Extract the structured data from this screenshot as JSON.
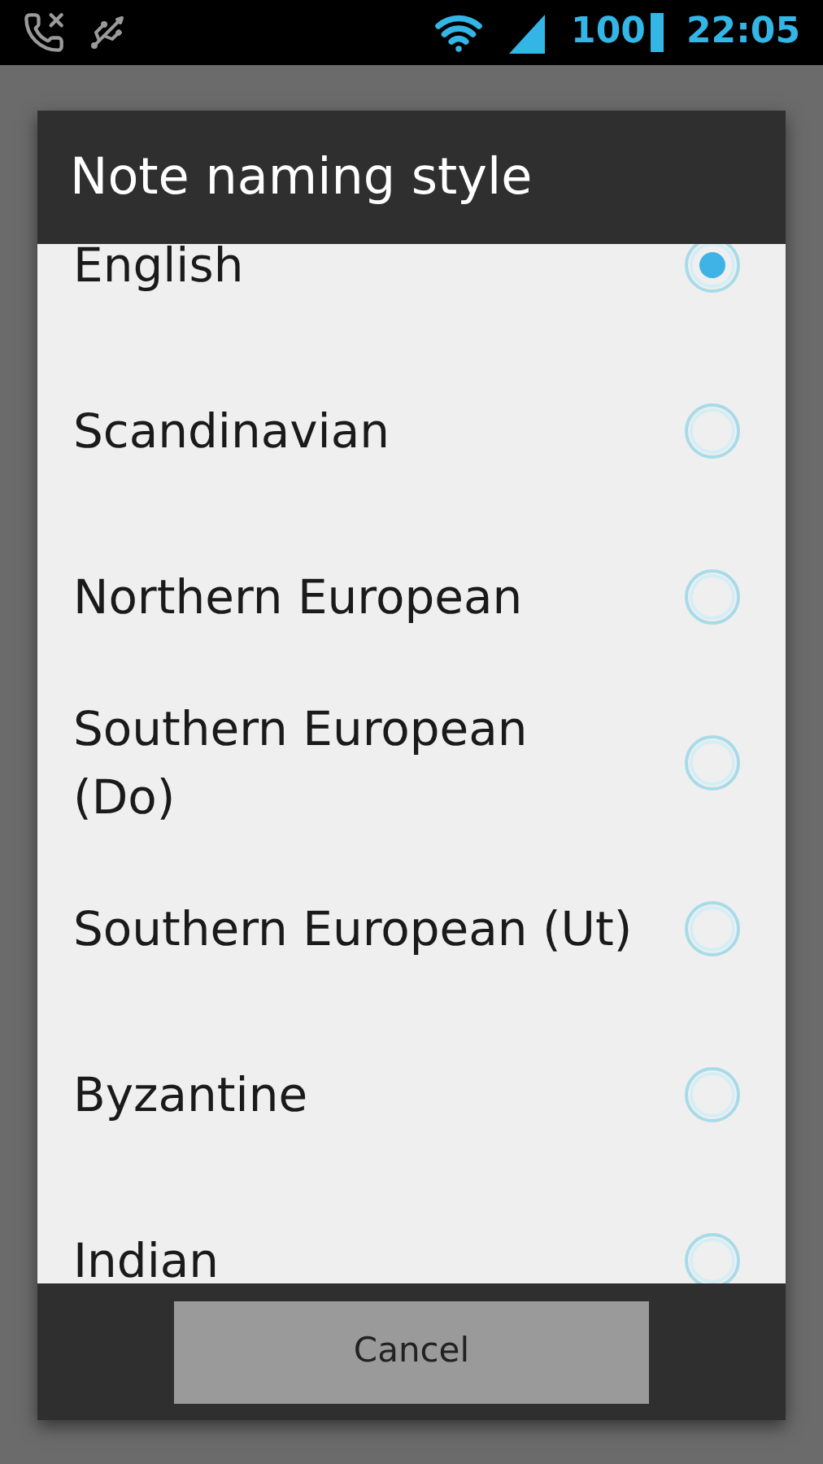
{
  "status_bar": {
    "battery": "100",
    "time": "22:05"
  },
  "dialog": {
    "title": "Note naming style",
    "options": [
      {
        "label": "English",
        "selected": true
      },
      {
        "label": "Scandinavian",
        "selected": false
      },
      {
        "label": "Northern European",
        "selected": false
      },
      {
        "label": "Southern European\n(Do)",
        "selected": false
      },
      {
        "label": "Southern European (Ut)",
        "selected": false
      },
      {
        "label": "Byzantine",
        "selected": false
      },
      {
        "label": "Indian",
        "selected": false
      }
    ],
    "buttons": [
      "Cancel"
    ]
  }
}
